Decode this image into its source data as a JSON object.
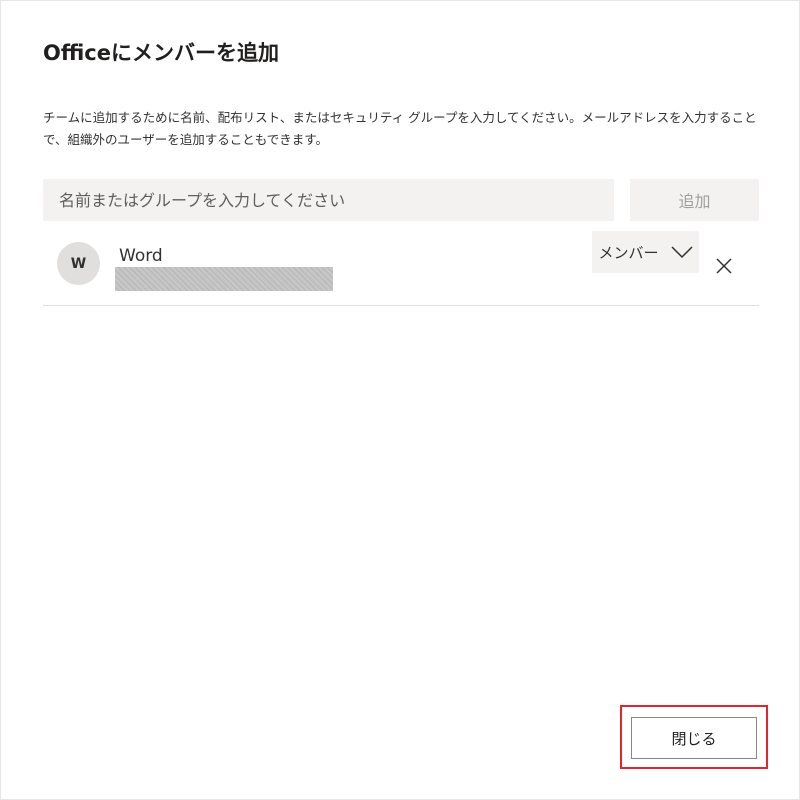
{
  "dialog": {
    "title": "Officeにメンバーを追加",
    "description": "チームに追加するために名前、配布リスト、またはセキュリティ グループを入力してください。メールアドレスを入力することで、組織外のユーザーを追加することもできます。"
  },
  "search": {
    "placeholder": "名前またはグループを入力してください",
    "value": ""
  },
  "add_button": {
    "label": "追加",
    "disabled": true
  },
  "members": [
    {
      "initial": "W",
      "name": "Word",
      "role": "メンバー",
      "icons": {
        "role_dropdown": "chevron-down-icon",
        "remove": "close-icon"
      }
    }
  ],
  "footer": {
    "close_label": "閉じる"
  },
  "colors": {
    "input_background": "#f3f2f1",
    "disabled_text": "#a19f9d",
    "avatar_background": "#e1dfdd",
    "highlight_border": "#e3262d",
    "divider": "#e1dfdd"
  }
}
